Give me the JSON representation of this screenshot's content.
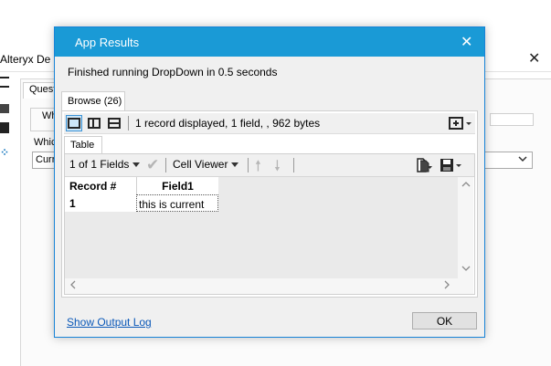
{
  "background_window": {
    "title": "Alteryx De",
    "close_glyph": "✕",
    "tab_label": "Quest",
    "groupbox_label": "Wh",
    "field_label": "Whic",
    "select_value": "Curr"
  },
  "dialog": {
    "title": "App Results",
    "close_glyph": "✕",
    "status": "Finished running DropDown in 0.5 seconds",
    "browse_tab": "Browse (26)",
    "record_summary": "1 record displayed, 1 field, , 962 bytes",
    "table_tab": "Table",
    "fields_select": "1 of 1 Fields",
    "cell_viewer": "Cell Viewer",
    "grid": {
      "columns": [
        "Record #",
        "Field1"
      ],
      "rows": [
        [
          "1",
          "this is current"
        ]
      ]
    },
    "output_log_link": "Show Output Log",
    "ok_button": "OK"
  },
  "colors": {
    "title_bar": "#1a9ad6",
    "link": "#0a58b8",
    "active_layout_bg": "#cde6f7"
  }
}
